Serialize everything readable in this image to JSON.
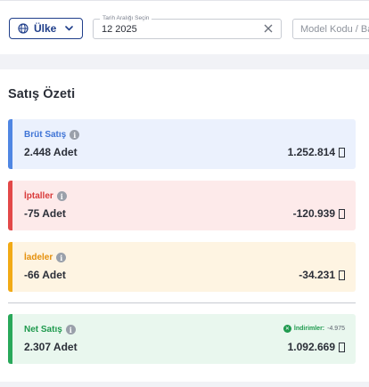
{
  "filters": {
    "country_label": "Ülke",
    "date_range_label": "Tarih Aralığı Seçin",
    "date_value": "12 2025",
    "model_placeholder": "Model Kodu / Barkod"
  },
  "summary": {
    "title": "Satış Özeti",
    "cards": {
      "gross": {
        "label": "Brüt Satış",
        "qty": "2.448 Adet",
        "amount": "1.252.814"
      },
      "cancellations": {
        "label": "İptaller",
        "qty": "-75 Adet",
        "amount": "-120.939"
      },
      "returns": {
        "label": "İadeler",
        "qty": "-66 Adet",
        "amount": "-34.231"
      },
      "net": {
        "label": "Net Satış",
        "qty": "2.307 Adet",
        "amount": "1.092.669",
        "discount_label": "İndirimler:",
        "discount_value": "-4.975"
      }
    }
  },
  "colors": {
    "gross": "#4f86e3",
    "cancellations": "#e34848",
    "returns": "#f2aa15",
    "net": "#29a85a",
    "country_button": "#1f3e8a"
  },
  "icons": {
    "country": "globe-icon",
    "dropdown": "chevron-down-icon",
    "clear": "close-icon",
    "info": "info-icon",
    "discount": "discount-icon",
    "currency": "currency-glyph"
  }
}
